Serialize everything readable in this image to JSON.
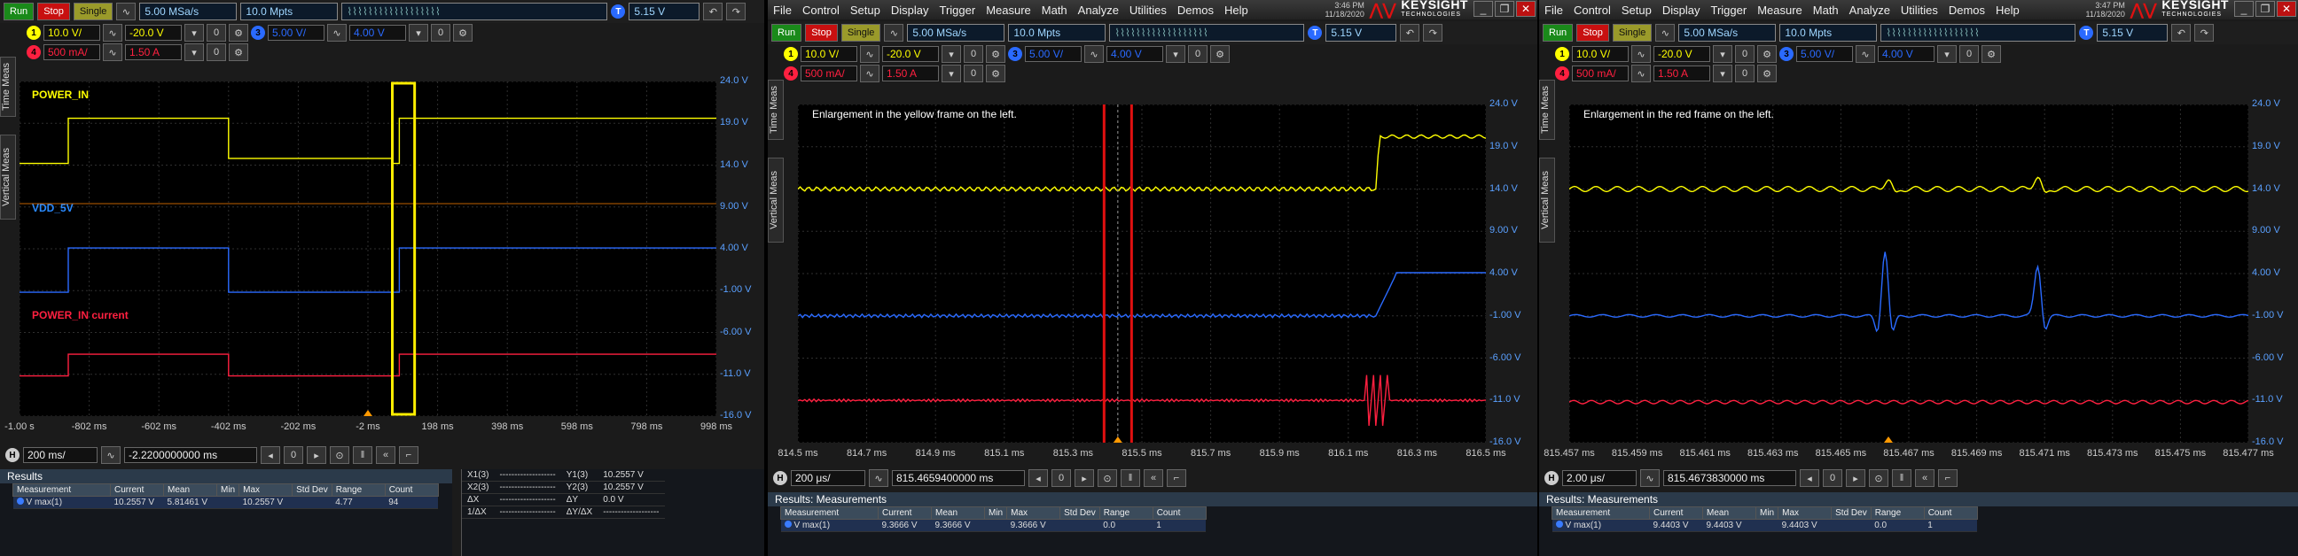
{
  "panels": [
    {
      "menu": [],
      "brand": null,
      "toolbar": {
        "run": "Run",
        "stop": "Stop",
        "single": "Single",
        "rate": "5.00 MSa/s",
        "points": "10.0 Mpts",
        "trig": "5.15 V"
      },
      "channels": [
        {
          "n": "1",
          "scale": "10.0 V/",
          "offset": "-20.0 V",
          "color": "#ffff00"
        },
        {
          "n": "3",
          "scale": "5.00 V/",
          "offset": "4.00 V",
          "color": "#2a6aff"
        },
        {
          "n": "4",
          "scale": "500 mA/",
          "offset": "1.50 A",
          "color": "#ff2040"
        }
      ],
      "sidetabs": [
        "Time Meas",
        "Vertical Meas"
      ],
      "yticks": [
        "24.0 V",
        "19.0 V",
        "14.0 V",
        "9.00 V",
        "4.00 V",
        "-1.00 V",
        "-6.00 V",
        "-11.0 V",
        "-16.0 V"
      ],
      "xticks": [
        "-1.00 s",
        "-802 ms",
        "-602 ms",
        "-402 ms",
        "-202 ms",
        "-2 ms",
        "198 ms",
        "398 ms",
        "598 ms",
        "798 ms",
        "998 ms"
      ],
      "labels": [
        {
          "text": "POWER_IN",
          "color": "#ffff00"
        },
        {
          "text": "VDD_5V",
          "color": "#2a8aff"
        },
        {
          "text": "POWER_IN current",
          "color": "#ff2040"
        }
      ],
      "note": "",
      "bottom": {
        "timebase": "200 ms/",
        "position": "-2.2200000000 ms"
      },
      "results": {
        "title": "Results",
        "cols": [
          "Measurement",
          "Current",
          "Mean",
          "Min",
          "Max",
          "Std Dev",
          "Range",
          "Count"
        ],
        "rows": [
          [
            "V max(1)",
            "10.2557 V",
            "5.81461 V",
            "",
            "10.2557 V",
            "",
            "4.77",
            "94"
          ]
        ]
      },
      "markers": {
        "rows": [
          [
            "X1(3)",
            "-------------------",
            "Y1(3)",
            "10.2557 V"
          ],
          [
            "X2(3)",
            "-------------------",
            "Y2(3)",
            "10.2557 V"
          ],
          [
            "ΔX",
            "-------------------",
            "ΔY",
            "0.0 V"
          ],
          [
            "1/ΔX",
            "-------------------",
            "ΔY/ΔX",
            "-------------------"
          ]
        ]
      }
    },
    {
      "menu": [
        "File",
        "Control",
        "Setup",
        "Display",
        "Trigger",
        "Measure",
        "Math",
        "Analyze",
        "Utilities",
        "Demos",
        "Help"
      ],
      "brand": {
        "time": "3:46 PM",
        "date": "11/18/2020",
        "name": "KEYSIGHT",
        "sub": "TECHNOLOGIES"
      },
      "toolbar": {
        "run": "Run",
        "stop": "Stop",
        "single": "Single",
        "rate": "5.00 MSa/s",
        "points": "10.0 Mpts",
        "trig": "5.15 V"
      },
      "channels": [
        {
          "n": "1",
          "scale": "10.0 V/",
          "offset": "-20.0 V",
          "color": "#ffff00"
        },
        {
          "n": "3",
          "scale": "5.00 V/",
          "offset": "4.00 V",
          "color": "#2a6aff"
        },
        {
          "n": "4",
          "scale": "500 mA/",
          "offset": "1.50 A",
          "color": "#ff2040"
        }
      ],
      "sidetabs": [
        "Time Meas",
        "Vertical Meas"
      ],
      "yticks": [
        "24.0 V",
        "19.0 V",
        "14.0 V",
        "9.00 V",
        "4.00 V",
        "-1.00 V",
        "-6.00 V",
        "-11.0 V",
        "-16.0 V"
      ],
      "xticks": [
        "814.5 ms",
        "814.7 ms",
        "814.9 ms",
        "815.1 ms",
        "815.3 ms",
        "815.5 ms",
        "815.7 ms",
        "815.9 ms",
        "816.1 ms",
        "816.3 ms",
        "816.5 ms"
      ],
      "labels": [],
      "note": "Enlargement in the yellow frame on the left.",
      "bottom": {
        "timebase": "200 μs/",
        "position": "815.4659400000 ms"
      },
      "results": {
        "title": "Results: Measurements",
        "cols": [
          "Measurement",
          "Current",
          "Mean",
          "Min",
          "Max",
          "Std Dev",
          "Range",
          "Count"
        ],
        "rows": [
          [
            "V max(1)",
            "9.3666 V",
            "9.3666 V",
            "",
            "9.3666 V",
            "",
            "0.0",
            "1"
          ]
        ]
      },
      "markers": null
    },
    {
      "menu": [
        "File",
        "Control",
        "Setup",
        "Display",
        "Trigger",
        "Measure",
        "Math",
        "Analyze",
        "Utilities",
        "Demos",
        "Help"
      ],
      "brand": {
        "time": "3:47 PM",
        "date": "11/18/2020",
        "name": "KEYSIGHT",
        "sub": "TECHNOLOGIES"
      },
      "toolbar": {
        "run": "Run",
        "stop": "Stop",
        "single": "Single",
        "rate": "5.00 MSa/s",
        "points": "10.0 Mpts",
        "trig": "5.15 V"
      },
      "channels": [
        {
          "n": "1",
          "scale": "10.0 V/",
          "offset": "-20.0 V",
          "color": "#ffff00"
        },
        {
          "n": "3",
          "scale": "5.00 V/",
          "offset": "4.00 V",
          "color": "#2a6aff"
        },
        {
          "n": "4",
          "scale": "500 mA/",
          "offset": "1.50 A",
          "color": "#ff2040"
        }
      ],
      "sidetabs": [
        "Time Meas",
        "Vertical Meas"
      ],
      "yticks": [
        "24.0 V",
        "19.0 V",
        "14.0 V",
        "9.00 V",
        "4.00 V",
        "-1.00 V",
        "-6.00 V",
        "-11.0 V",
        "-16.0 V"
      ],
      "xticks": [
        "815.457 ms",
        "815.459 ms",
        "815.461 ms",
        "815.463 ms",
        "815.465 ms",
        "815.467 ms",
        "815.469 ms",
        "815.471 ms",
        "815.473 ms",
        "815.475 ms",
        "815.477 ms"
      ],
      "labels": [],
      "note": "Enlargement in the red frame on the left.",
      "bottom": {
        "timebase": "2.00 μs/",
        "position": "815.4673830000 ms"
      },
      "results": {
        "title": "Results: Measurements",
        "cols": [
          "Measurement",
          "Current",
          "Mean",
          "Min",
          "Max",
          "Std Dev",
          "Range",
          "Count"
        ],
        "rows": [
          [
            "V max(1)",
            "9.4403 V",
            "9.4403 V",
            "",
            "9.4403 V",
            "",
            "0.0",
            "1"
          ]
        ]
      },
      "markers": null
    }
  ],
  "colors": {
    "yellow": "#ffff00",
    "blue": "#2a6aff",
    "red": "#ff2040",
    "frame_yellow": "#ffee00",
    "frame_red": "#e01010"
  }
}
